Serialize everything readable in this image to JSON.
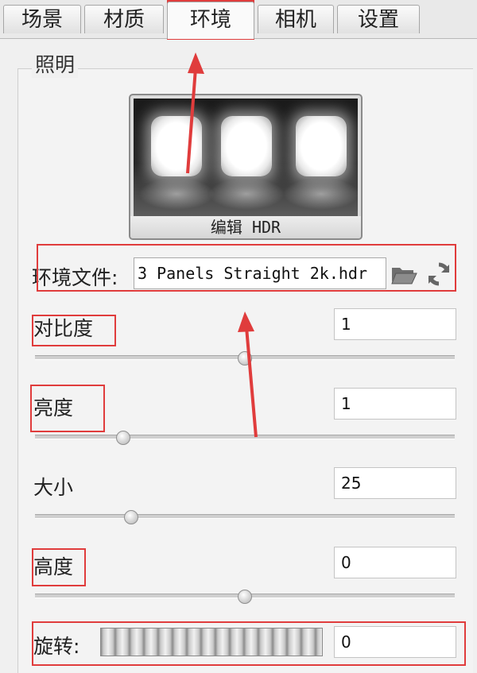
{
  "tabs": [
    {
      "label": "场景"
    },
    {
      "label": "材质"
    },
    {
      "label": "环境",
      "active": true
    },
    {
      "label": "相机"
    },
    {
      "label": "设置"
    }
  ],
  "lighting": {
    "group_title": "照明",
    "hdr_button_label": "编辑 HDR",
    "env_file_label": "环境文件:",
    "env_file_value": "3 Panels Straight 2k.hdr"
  },
  "params": {
    "contrast": {
      "label": "对比度",
      "value": "1",
      "slider": 0.5
    },
    "brightness": {
      "label": "亮度",
      "value": "1",
      "slider": 0.21
    },
    "size": {
      "label": "大小",
      "value": "25",
      "slider": 0.23
    },
    "height": {
      "label": "高度",
      "value": "0",
      "slider": 0.5
    },
    "rotation": {
      "label": "旋转:",
      "value": "0"
    }
  },
  "icons": {
    "open_folder": "folder-open-icon",
    "refresh": "refresh-icon"
  },
  "colors": {
    "annotation": "#e03c3c"
  }
}
